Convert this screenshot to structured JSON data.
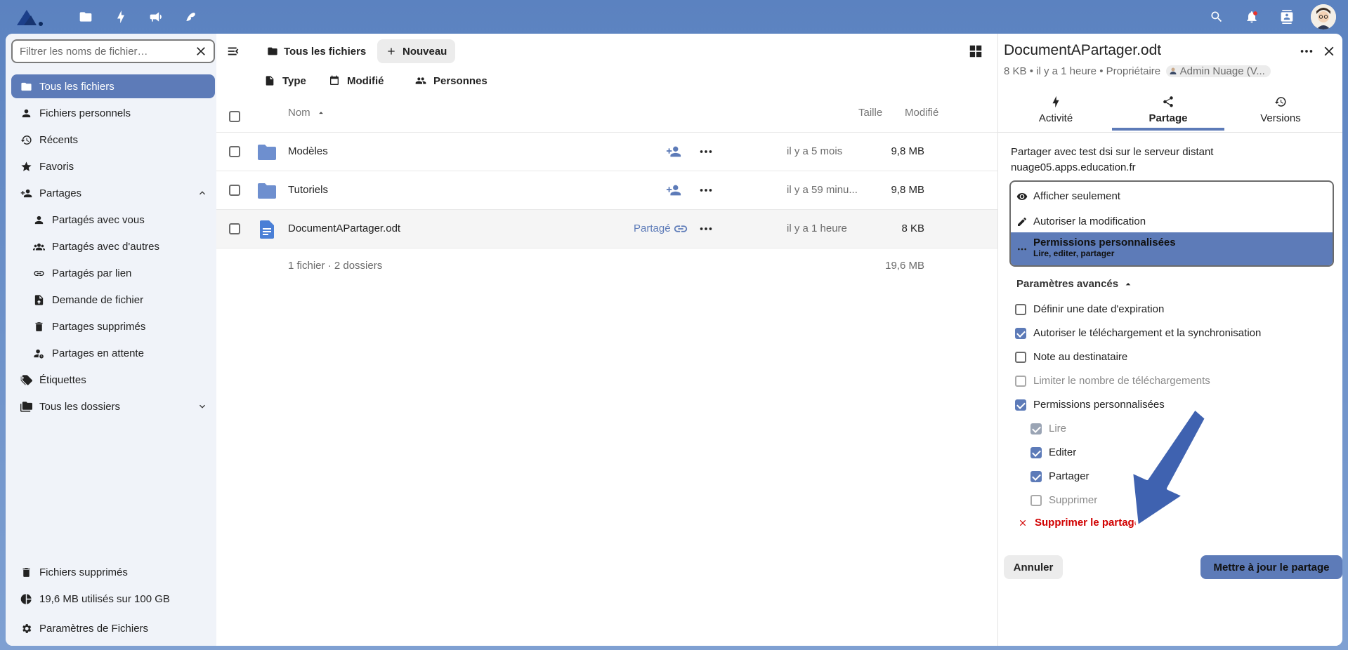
{
  "topbar": {
    "logo": "nextcloud-logo",
    "apps": [
      "files-icon",
      "activity-icon",
      "announcements-icon",
      "notes-icon"
    ],
    "right": [
      "search-icon",
      "notifications-icon",
      "contacts-icon",
      "avatar"
    ]
  },
  "nav": {
    "filter_placeholder": "Filtrer les noms de fichier…",
    "items": [
      {
        "label": "Tous les fichiers",
        "icon": "folder-icon"
      },
      {
        "label": "Fichiers personnels",
        "icon": "account-icon"
      },
      {
        "label": "Récents",
        "icon": "history-icon"
      },
      {
        "label": "Favoris",
        "icon": "star-icon"
      },
      {
        "label": "Partages",
        "icon": "share-account-icon"
      },
      {
        "label": "Partagés avec vous",
        "icon": "account-icon"
      },
      {
        "label": "Partagés avec d'autres",
        "icon": "account-group-icon"
      },
      {
        "label": "Partagés par lien",
        "icon": "link-icon"
      },
      {
        "label": "Demande de fichier",
        "icon": "file-upload-icon"
      },
      {
        "label": "Partages supprimés",
        "icon": "trash-icon"
      },
      {
        "label": "Partages en attente",
        "icon": "account-clock-icon"
      },
      {
        "label": "Étiquettes",
        "icon": "tag-icon"
      },
      {
        "label": "Tous les dossiers",
        "icon": "folder-multiple-icon"
      }
    ],
    "bottom": {
      "trash": "Fichiers supprimés",
      "quota": "19,6 MB utilisés sur 100 GB",
      "settings": "Paramètres de Fichiers"
    }
  },
  "files": {
    "breadcrumb": "Tous les fichiers",
    "new_label": "Nouveau",
    "filters": [
      "Type",
      "Modifié",
      "Personnes"
    ],
    "columns": {
      "name": "Nom",
      "size": "Taille",
      "modified": "Modifié"
    },
    "rows": [
      {
        "name": "Modèles",
        "size": "9,8 MB",
        "modified": "il y a 5 mois",
        "type": "folder"
      },
      {
        "name": "Tutoriels",
        "size": "9,8 MB",
        "modified": "il y a 59 minu...",
        "type": "folder"
      },
      {
        "name": "DocumentAPartager.odt",
        "size": "8 KB",
        "modified": "il y a 1 heure",
        "type": "document",
        "shared_label": "Partagé"
      }
    ],
    "summary": "1 fichier · 2 dossiers",
    "summary_size": "19,6 MB"
  },
  "sidebar": {
    "title": "DocumentAPartager.odt",
    "size": "8 KB",
    "time": "il y a 1 heure",
    "owner_label": "Propriétaire",
    "owner_name": "Admin Nuage (V...",
    "tabs": [
      "Activité",
      "Partage",
      "Versions"
    ],
    "share_desc_1": "Partager avec test dsi sur le serveur distant",
    "share_desc_2": "nuage05.apps.education.fr",
    "perm_options": {
      "view": "Afficher seulement",
      "edit": "Autoriser la modification",
      "custom": "Permissions personnalisées",
      "custom_sub": "Lire, editer, partager"
    },
    "advanced_label": "Paramètres avancés",
    "checks": [
      {
        "label": "Définir une date d'expiration",
        "checked": false,
        "disabled": false
      },
      {
        "label": "Autoriser le téléchargement et la synchronisation",
        "checked": true,
        "disabled": false
      },
      {
        "label": "Note au destinataire",
        "checked": false,
        "disabled": false
      },
      {
        "label": "Limiter le nombre de téléchargements",
        "checked": false,
        "disabled": true
      },
      {
        "label": "Permissions personnalisées",
        "checked": true,
        "disabled": false
      }
    ],
    "sub_checks": [
      {
        "label": "Lire",
        "checked": true,
        "disabled": true
      },
      {
        "label": "Editer",
        "checked": true,
        "disabled": false
      },
      {
        "label": "Partager",
        "checked": true,
        "disabled": false
      },
      {
        "label": "Supprimer",
        "checked": false,
        "disabled": true
      }
    ],
    "delete_share": "Supprimer le partage",
    "cancel": "Annuler",
    "update": "Mettre à jour le partage"
  },
  "colors": {
    "accent": "#5d7bb8",
    "danger": "#d10000",
    "background_top": "#5b82c0"
  }
}
